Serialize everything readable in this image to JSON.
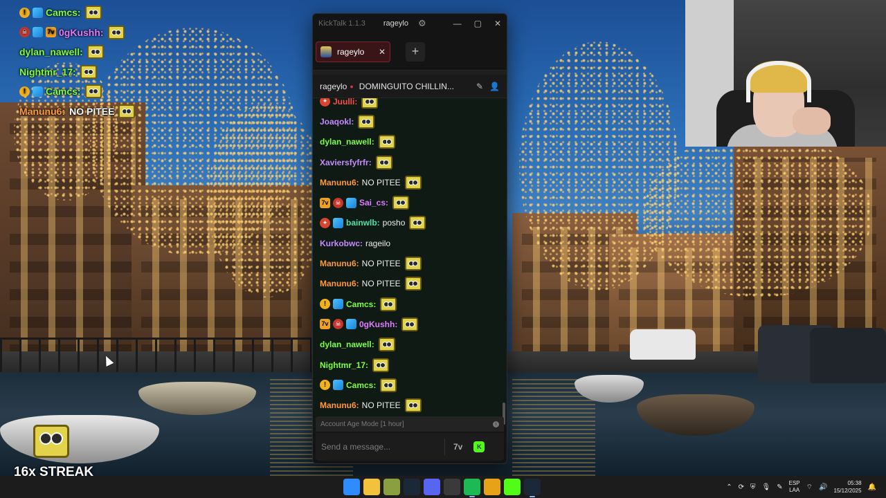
{
  "overlay_chat": [
    {
      "badges": [
        "coin",
        "cube"
      ],
      "user": "Camcs:",
      "color": "#7cff3f",
      "text": "",
      "emote": true
    },
    {
      "badges": [
        "skull",
        "cube",
        "7tv"
      ],
      "user": "0gKushh:",
      "color": "#e07bff",
      "text": "",
      "emote": true
    },
    {
      "badges": [],
      "user": "dylan_nawell:",
      "color": "#7cff3f",
      "text": "",
      "emote": true
    },
    {
      "badges": [],
      "user": "Nightmr_17:",
      "color": "#7cff3f",
      "text": "",
      "emote": true
    },
    {
      "badges": [
        "coin",
        "cube"
      ],
      "user": "Camcs:",
      "color": "#7cff3f",
      "text": "",
      "emote": true
    },
    {
      "badges": [],
      "user": "Manunu6:",
      "color": "#ff9a3c",
      "text": "NO PITEE",
      "emote": true
    }
  ],
  "window": {
    "app_name": "KickTalk 1.1.3",
    "title_user": "rageylo",
    "tab": {
      "name": "rageylo"
    },
    "stream": {
      "user": "rageylo",
      "title": "DOMINGUITO CHILLIN..."
    }
  },
  "chat": [
    {
      "badges": [
        "fire"
      ],
      "user": "Juulli:",
      "color": "#ff4a4a",
      "text": "",
      "emote": true
    },
    {
      "badges": [],
      "user": "Joaqokl:",
      "color": "#c48bff",
      "text": "",
      "emote": true
    },
    {
      "badges": [],
      "user": "dylan_nawell:",
      "color": "#7cff3f",
      "text": "",
      "emote": true
    },
    {
      "badges": [],
      "user": "Xaviersfyfrfr:",
      "color": "#c48bff",
      "text": "",
      "emote": true
    },
    {
      "badges": [],
      "user": "Manunu6:",
      "color": "#ff9a3c",
      "text": "NO PITEE",
      "emote": true
    },
    {
      "badges": [
        "7tv",
        "skull",
        "cube"
      ],
      "user": "Sai_cs:",
      "color": "#e07bff",
      "text": "",
      "emote": true
    },
    {
      "badges": [
        "fire",
        "cube"
      ],
      "user": "bainwlb:",
      "color": "#53e0a6",
      "text": "posho",
      "emote": true
    },
    {
      "badges": [],
      "user": "Kurkobwc:",
      "color": "#c48bff",
      "text": "rageilo",
      "emote": false
    },
    {
      "badges": [],
      "user": "Manunu6:",
      "color": "#ff9a3c",
      "text": "NO PITEE",
      "emote": true
    },
    {
      "badges": [],
      "user": "Manunu6:",
      "color": "#ff9a3c",
      "text": "NO PITEE",
      "emote": true
    },
    {
      "badges": [
        "coin",
        "cube"
      ],
      "user": "Camcs:",
      "color": "#7cff3f",
      "text": "",
      "emote": true
    },
    {
      "badges": [
        "7tv",
        "skull",
        "cube"
      ],
      "user": "0gKushh:",
      "color": "#e07bff",
      "text": "",
      "emote": true
    },
    {
      "badges": [],
      "user": "dylan_nawell:",
      "color": "#7cff3f",
      "text": "",
      "emote": true
    },
    {
      "badges": [],
      "user": "Nightmr_17:",
      "color": "#7cff3f",
      "text": "",
      "emote": true
    },
    {
      "badges": [
        "coin",
        "cube"
      ],
      "user": "Camcs:",
      "color": "#7cff3f",
      "text": "",
      "emote": true
    },
    {
      "badges": [],
      "user": "Manunu6:",
      "color": "#ff9a3c",
      "text": "NO PITEE",
      "emote": true
    }
  ],
  "mode_banner": "Account Age Mode [1 hour]",
  "composer": {
    "placeholder": "Send a message..."
  },
  "streak": {
    "text": "16x STREAK"
  },
  "taskbar": {
    "apps": [
      {
        "name": "windows-start-icon",
        "color": "#2f8cff"
      },
      {
        "name": "file-explorer-icon",
        "color": "#f3c23c"
      },
      {
        "name": "game-launcher-icon",
        "color": "#8aa040"
      },
      {
        "name": "steam-icon",
        "color": "#1b2838"
      },
      {
        "name": "discord-icon",
        "color": "#5865f2"
      },
      {
        "name": "obs-icon",
        "color": "#3a3a3a"
      },
      {
        "name": "spotify-icon",
        "color": "#1db954"
      },
      {
        "name": "chrome-icon",
        "color": "#e8a21a"
      },
      {
        "name": "kick-icon",
        "color": "#53fc18"
      },
      {
        "name": "steam-active-icon",
        "color": "#1b2838"
      }
    ],
    "lang_top": "ESP",
    "lang_bottom": "LAA",
    "time": "05:38",
    "date": "15/12/2025"
  }
}
